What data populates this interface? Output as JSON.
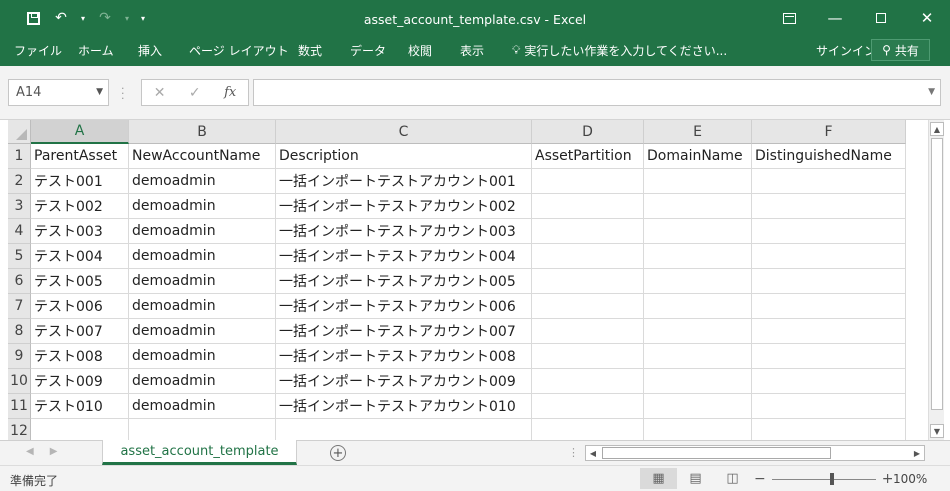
{
  "window": {
    "title": "asset_account_template.csv  -  Excel",
    "qat_customize": "▾"
  },
  "ribbon": {
    "tabs": [
      "ファイル",
      "ホーム",
      "挿入",
      "ページ レイアウト",
      "数式",
      "データ",
      "校閲",
      "表示"
    ],
    "tell_me": "実行したい作業を入力してください...",
    "sign_in": "サインイン",
    "share": "共有"
  },
  "formula_bar": {
    "name_box": "A14",
    "cancel": "✕",
    "enter": "✓",
    "fx": "fx",
    "value": ""
  },
  "grid": {
    "columns": [
      "A",
      "B",
      "C",
      "D",
      "E",
      "F"
    ],
    "selected_column": "A",
    "row_numbers": [
      "1",
      "2",
      "3",
      "4",
      "5",
      "6",
      "7",
      "8",
      "9",
      "10",
      "11",
      "12"
    ],
    "rows": [
      [
        "ParentAsset",
        "NewAccountName",
        "Description",
        "AssetPartition",
        "DomainName",
        "DistinguishedName"
      ],
      [
        "テスト001",
        "demoadmin",
        "一括インポートテストアカウント001",
        "",
        "",
        ""
      ],
      [
        "テスト002",
        "demoadmin",
        "一括インポートテストアカウント002",
        "",
        "",
        ""
      ],
      [
        "テスト003",
        "demoadmin",
        "一括インポートテストアカウント003",
        "",
        "",
        ""
      ],
      [
        "テスト004",
        "demoadmin",
        "一括インポートテストアカウント004",
        "",
        "",
        ""
      ],
      [
        "テスト005",
        "demoadmin",
        "一括インポートテストアカウント005",
        "",
        "",
        ""
      ],
      [
        "テスト006",
        "demoadmin",
        "一括インポートテストアカウント006",
        "",
        "",
        ""
      ],
      [
        "テスト007",
        "demoadmin",
        "一括インポートテストアカウント007",
        "",
        "",
        ""
      ],
      [
        "テスト008",
        "demoadmin",
        "一括インポートテストアカウント008",
        "",
        "",
        ""
      ],
      [
        "テスト009",
        "demoadmin",
        "一括インポートテストアカウント009",
        "",
        "",
        ""
      ],
      [
        "テスト010",
        "demoadmin",
        "一括インポートテストアカウント010",
        "",
        "",
        ""
      ],
      [
        "",
        "",
        "",
        "",
        "",
        ""
      ]
    ]
  },
  "sheets": {
    "active": "asset_account_template",
    "add": "+"
  },
  "status": {
    "mode": "準備完了",
    "zoom": "100%",
    "zoom_minus": "−",
    "zoom_plus": "+"
  },
  "colors": {
    "accent": "#217346"
  }
}
